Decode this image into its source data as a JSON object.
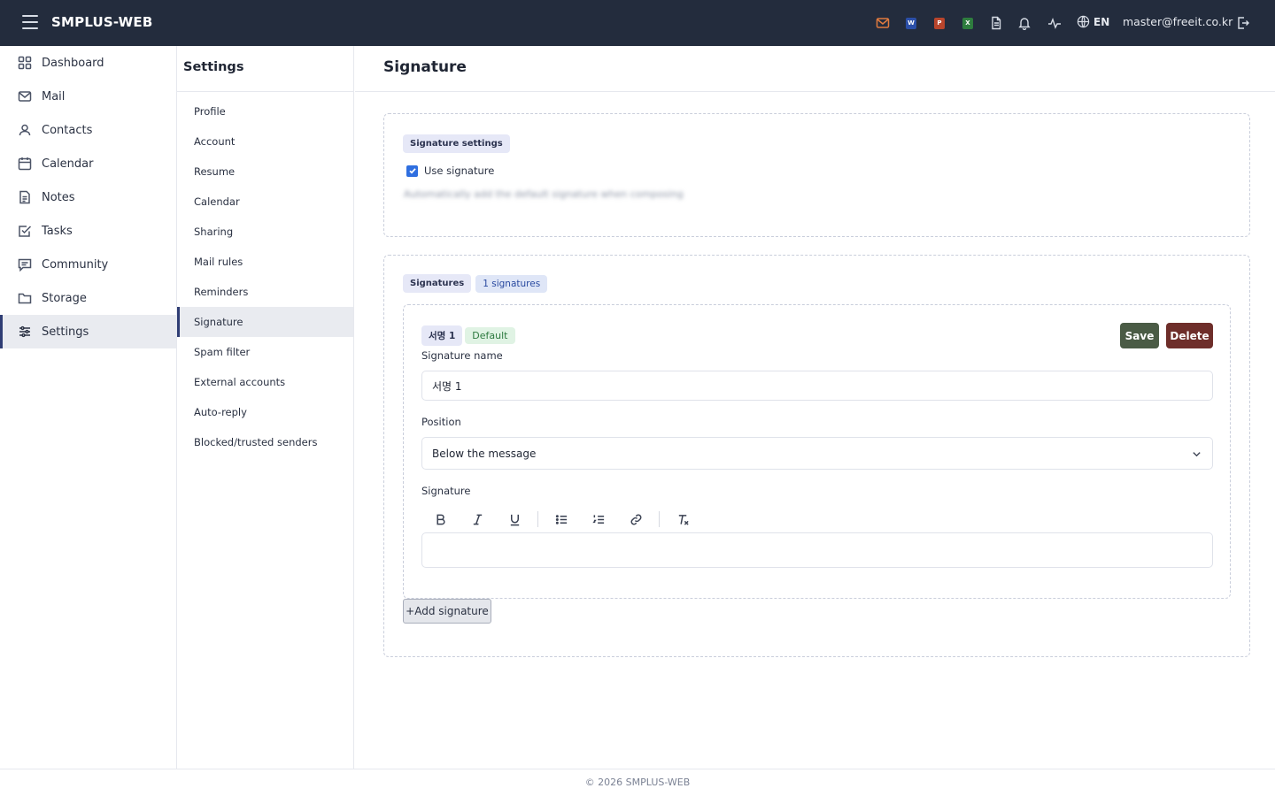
{
  "app": {
    "title": "SMPLUS-WEB"
  },
  "topbar": {
    "doc_badges": {
      "word": "W",
      "powerpoint": "P",
      "excel": "X"
    },
    "language": "EN",
    "user_email": "master@freeit.co.kr",
    "colors": {
      "mail": "#e07a3f",
      "word": "#2b4fa8",
      "powerpoint": "#b8452c",
      "excel": "#2e7d3e"
    }
  },
  "leftnav": {
    "items": [
      {
        "label": "Dashboard",
        "icon": "grid-icon"
      },
      {
        "label": "Mail",
        "icon": "mail-icon"
      },
      {
        "label": "Contacts",
        "icon": "contacts-icon"
      },
      {
        "label": "Calendar",
        "icon": "calendar-icon"
      },
      {
        "label": "Notes",
        "icon": "notes-icon"
      },
      {
        "label": "Tasks",
        "icon": "tasks-icon"
      },
      {
        "label": "Community",
        "icon": "community-icon"
      },
      {
        "label": "Storage",
        "icon": "folder-icon"
      },
      {
        "label": "Settings",
        "icon": "settings-sliders-icon",
        "active": true
      }
    ]
  },
  "subnav": {
    "title": "Settings",
    "items": [
      {
        "label": "Profile"
      },
      {
        "label": "Account"
      },
      {
        "label": "Resume"
      },
      {
        "label": "Calendar"
      },
      {
        "label": "Sharing"
      },
      {
        "label": "Mail rules"
      },
      {
        "label": "Reminders"
      },
      {
        "label": "Signature",
        "active": true
      },
      {
        "label": "Spam filter"
      },
      {
        "label": "External accounts"
      },
      {
        "label": "Auto-reply"
      },
      {
        "label": "Blocked/trusted senders"
      }
    ]
  },
  "main": {
    "title": "Signature",
    "settings_card": {
      "badge": "Signature settings",
      "use_signature_label": "Use signature",
      "use_signature_checked": true,
      "hint": "Automatically add the default signature when composing"
    },
    "signatures_card": {
      "badge": "Signatures",
      "count_badge": "1 signatures",
      "signature": {
        "name_badge": "서명 1",
        "default_badge": "Default",
        "save_label": "Save",
        "delete_label": "Delete",
        "name_label": "Signature name",
        "name_value": "서명 1",
        "position_label": "Position",
        "position_value": "Below the message",
        "body_label": "Signature",
        "body_value": ""
      },
      "add_label": "+Add signature"
    }
  },
  "footer": {
    "text": "© 2026 SMPLUS-WEB"
  }
}
